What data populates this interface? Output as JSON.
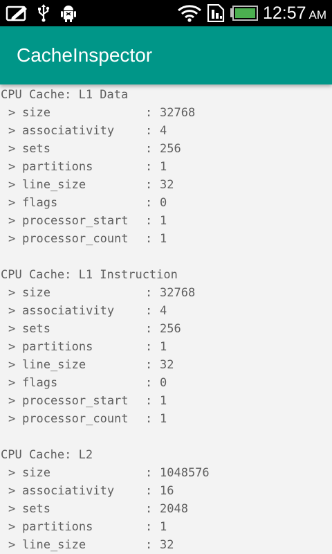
{
  "status_bar": {
    "time": "12:57",
    "ampm": "AM",
    "icons": [
      "edit-icon",
      "usb-icon",
      "android-debug-icon",
      "wifi-icon",
      "sim-card-icon",
      "battery-icon"
    ],
    "accent_color": "#4caf50"
  },
  "app_bar": {
    "title": "CacheInspector",
    "color": "#009688"
  },
  "caches": [
    {
      "title": "CPU Cache: L1 Data",
      "props": [
        {
          "arrow": ">",
          "key": "size",
          "sep": ":",
          "value": "32768"
        },
        {
          "arrow": ">",
          "key": "associativity",
          "sep": ":",
          "value": "4"
        },
        {
          "arrow": ">",
          "key": "sets",
          "sep": ":",
          "value": "256"
        },
        {
          "arrow": ">",
          "key": "partitions",
          "sep": ":",
          "value": "1"
        },
        {
          "arrow": ">",
          "key": "line_size",
          "sep": ":",
          "value": "32"
        },
        {
          "arrow": ">",
          "key": "flags",
          "sep": ":",
          "value": "0"
        },
        {
          "arrow": ">",
          "key": "processor_start",
          "sep": ":",
          "value": "1"
        },
        {
          "arrow": ">",
          "key": "processor_count",
          "sep": ":",
          "value": "1"
        }
      ]
    },
    {
      "title": "CPU Cache: L1 Instruction",
      "props": [
        {
          "arrow": ">",
          "key": "size",
          "sep": ":",
          "value": "32768"
        },
        {
          "arrow": ">",
          "key": "associativity",
          "sep": ":",
          "value": "4"
        },
        {
          "arrow": ">",
          "key": "sets",
          "sep": ":",
          "value": "256"
        },
        {
          "arrow": ">",
          "key": "partitions",
          "sep": ":",
          "value": "1"
        },
        {
          "arrow": ">",
          "key": "line_size",
          "sep": ":",
          "value": "32"
        },
        {
          "arrow": ">",
          "key": "flags",
          "sep": ":",
          "value": "0"
        },
        {
          "arrow": ">",
          "key": "processor_start",
          "sep": ":",
          "value": "1"
        },
        {
          "arrow": ">",
          "key": "processor_count",
          "sep": ":",
          "value": "1"
        }
      ]
    },
    {
      "title": "CPU Cache: L2",
      "props": [
        {
          "arrow": ">",
          "key": "size",
          "sep": ":",
          "value": "1048576"
        },
        {
          "arrow": ">",
          "key": "associativity",
          "sep": ":",
          "value": "16"
        },
        {
          "arrow": ">",
          "key": "sets",
          "sep": ":",
          "value": "2048"
        },
        {
          "arrow": ">",
          "key": "partitions",
          "sep": ":",
          "value": "1"
        },
        {
          "arrow": ">",
          "key": "line_size",
          "sep": ":",
          "value": "32"
        }
      ]
    }
  ]
}
